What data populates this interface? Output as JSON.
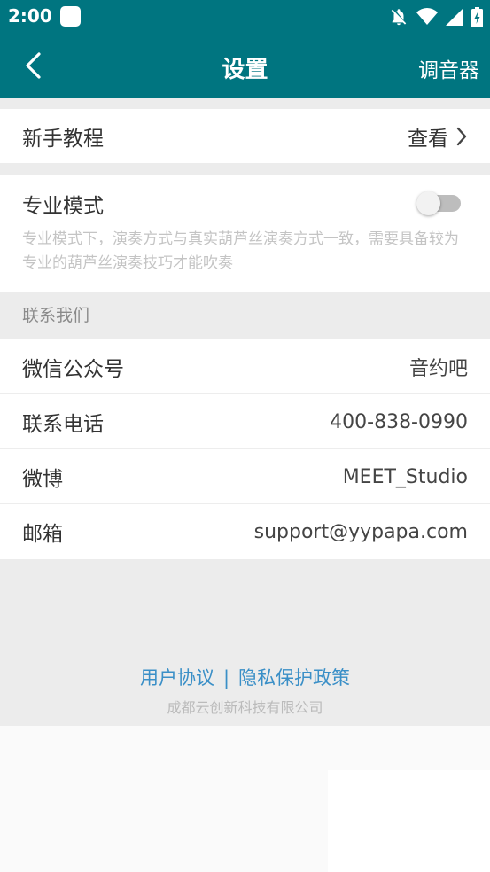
{
  "status_bar": {
    "time": "2:00",
    "icons": [
      "notification-app-icon",
      "bell-off-icon",
      "wifi-icon",
      "signal-icon",
      "battery-charging-icon"
    ]
  },
  "app_bar": {
    "back_icon": "chevron-left-icon",
    "title": "设置",
    "tuner_label": "调音器"
  },
  "tutorial": {
    "label": "新手教程",
    "value": "查看",
    "icon": "chevron-right-icon"
  },
  "pro_mode": {
    "label": "专业模式",
    "description": "专业模式下，演奏方式与真实葫芦丝演奏方式一致，需要具备较为专业的葫芦丝演奏技巧才能吹奏",
    "enabled": false
  },
  "contact": {
    "header": "联系我们",
    "items": [
      {
        "label": "微信公众号",
        "value": "音约吧"
      },
      {
        "label": "联系电话",
        "value": "400-838-0990"
      },
      {
        "label": "微博",
        "value": "MEET_Studio"
      },
      {
        "label": "邮箱",
        "value": "support@yypapa.com"
      }
    ]
  },
  "footer": {
    "user_agreement": "用户协议",
    "separator": "|",
    "privacy_policy": "隐私保护政策",
    "company": "成都云创新科技有限公司"
  },
  "colors": {
    "primary": "#007580",
    "link": "#3a8fc7",
    "background": "#ececec"
  }
}
